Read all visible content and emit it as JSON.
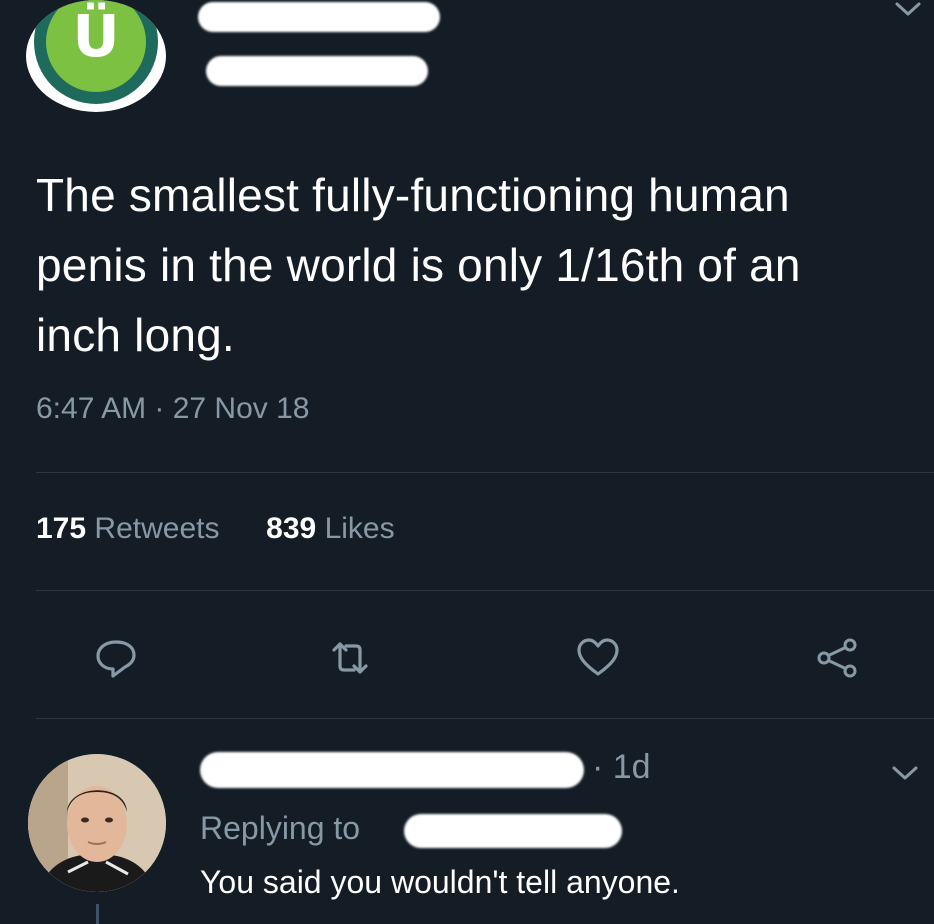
{
  "tweet": {
    "text": "The smallest fully-functioning human penis in the world is only 1/16th of an inch long.",
    "timestamp": "6:47 AM · 27 Nov 18",
    "avatar_letter": "Ü"
  },
  "stats": {
    "retweets_count": "175",
    "retweets_label": "Retweets",
    "likes_count": "839",
    "likes_label": "Likes"
  },
  "actions": {
    "reply_icon": "reply-icon",
    "retweet_icon": "retweet-icon",
    "like_icon": "heart-icon",
    "share_icon": "share-icon"
  },
  "reply": {
    "time": "· 1d",
    "replying_to_label": "Replying to",
    "text": "You said you wouldn't tell anyone."
  },
  "colors": {
    "background": "#141d26",
    "secondary_text": "#8899a6",
    "primary_text": "#ffffff",
    "logo_green": "#7cc142",
    "logo_teal": "#1e6a5c"
  }
}
